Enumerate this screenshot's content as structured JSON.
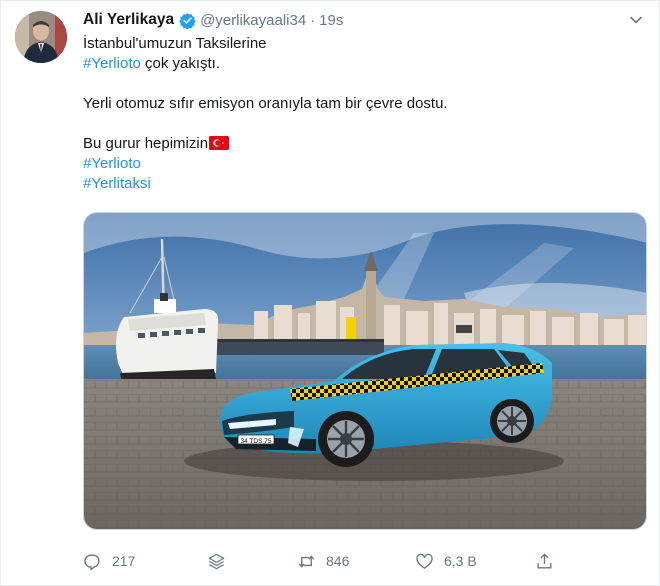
{
  "tweet": {
    "author_name": "Ali Yerlikaya",
    "handle": "@yerlikayaali34",
    "separator": "·",
    "time": "19s",
    "lines": {
      "l1": "İstanbul'umuzun Taksilerine",
      "l2_tag": "#Yerlioto",
      "l2_rest": " çok yakıştı.",
      "l3": "Yerli otomuz sıfır emisyon oranıyla tam bir çevre dostu.",
      "l4": "Bu gurur hepimizin",
      "l5_tag": "#Yerlioto",
      "l6_tag": "#Yerlitaksi"
    },
    "plate_text": "34 TDS 75"
  },
  "actions": {
    "reply_count": "217",
    "retweet_count": "846",
    "like_count": "6,3 B"
  },
  "colors": {
    "link": "#1b95e0",
    "muted": "#657786",
    "verified": "#1da1f2",
    "taxi": "#2fa8d8"
  },
  "icons": [
    "avatar",
    "verified-badge-icon",
    "chevron-down-icon",
    "turkish-flag-icon",
    "reply-icon",
    "layers-icon",
    "retweet-icon",
    "heart-icon",
    "share-icon"
  ]
}
